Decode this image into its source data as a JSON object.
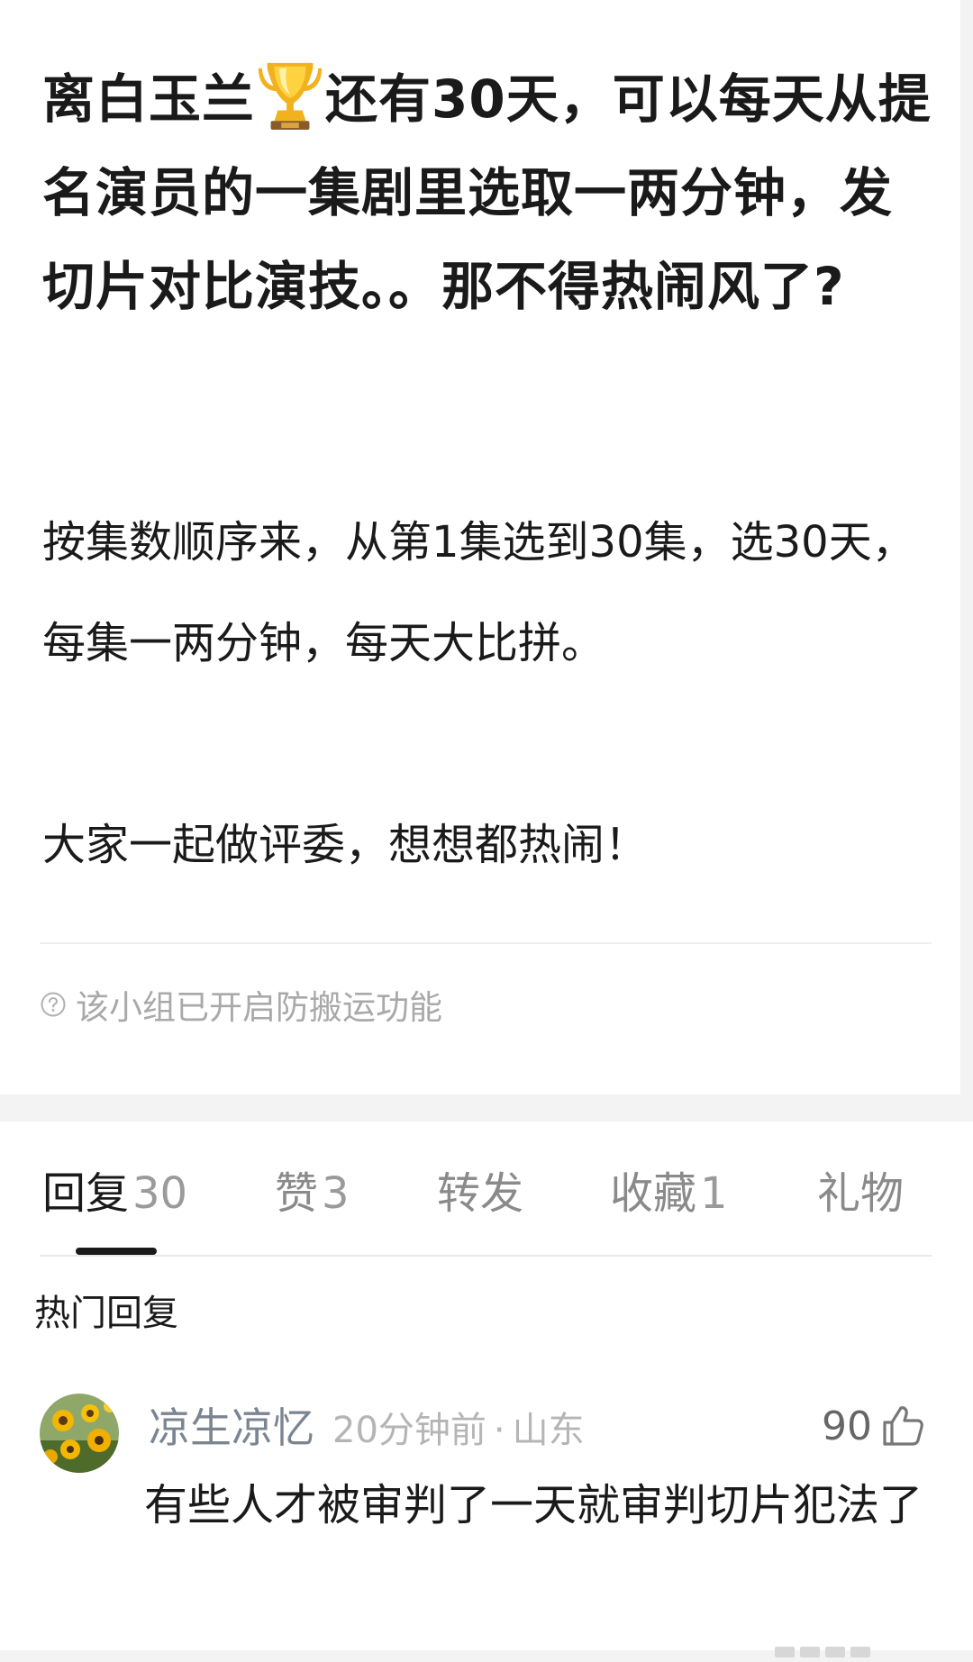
{
  "post": {
    "title_part1": "离白玉兰",
    "title_part2": "还有30天，可以每天从提名演员的一集剧里选取一两分钟，发切片对比演技。。那不得热闹风了?",
    "trophy_icon": "trophy-icon",
    "body_para1": "按集数顺序来，从第1集选到30集，选30天，每集一两分钟，每天大比拼。",
    "body_para2": "大家一起做评委，想想都热闹！",
    "notice": "该小组已开启防搬运功能",
    "notice_icon": "question-circle-icon"
  },
  "tabs": [
    {
      "label": "回复",
      "count": "30",
      "active": true
    },
    {
      "label": "赞",
      "count": "3",
      "active": false
    },
    {
      "label": "转发",
      "count": "",
      "active": false
    },
    {
      "label": "收藏",
      "count": "1",
      "active": false
    },
    {
      "label": "礼物",
      "count": "",
      "active": false
    }
  ],
  "section_title": "热门回复",
  "comments": [
    {
      "user": "凉生凉忆",
      "time": "20分钟前",
      "dot": "·",
      "location": "山东",
      "likes": "90",
      "text": "有些人才被审判了一天就审判切片犯法了"
    }
  ],
  "colors": {
    "text": "#1a1a1a",
    "muted": "#a9a9a9",
    "username": "#7b8591",
    "gap_bg": "#f3f3f3"
  }
}
